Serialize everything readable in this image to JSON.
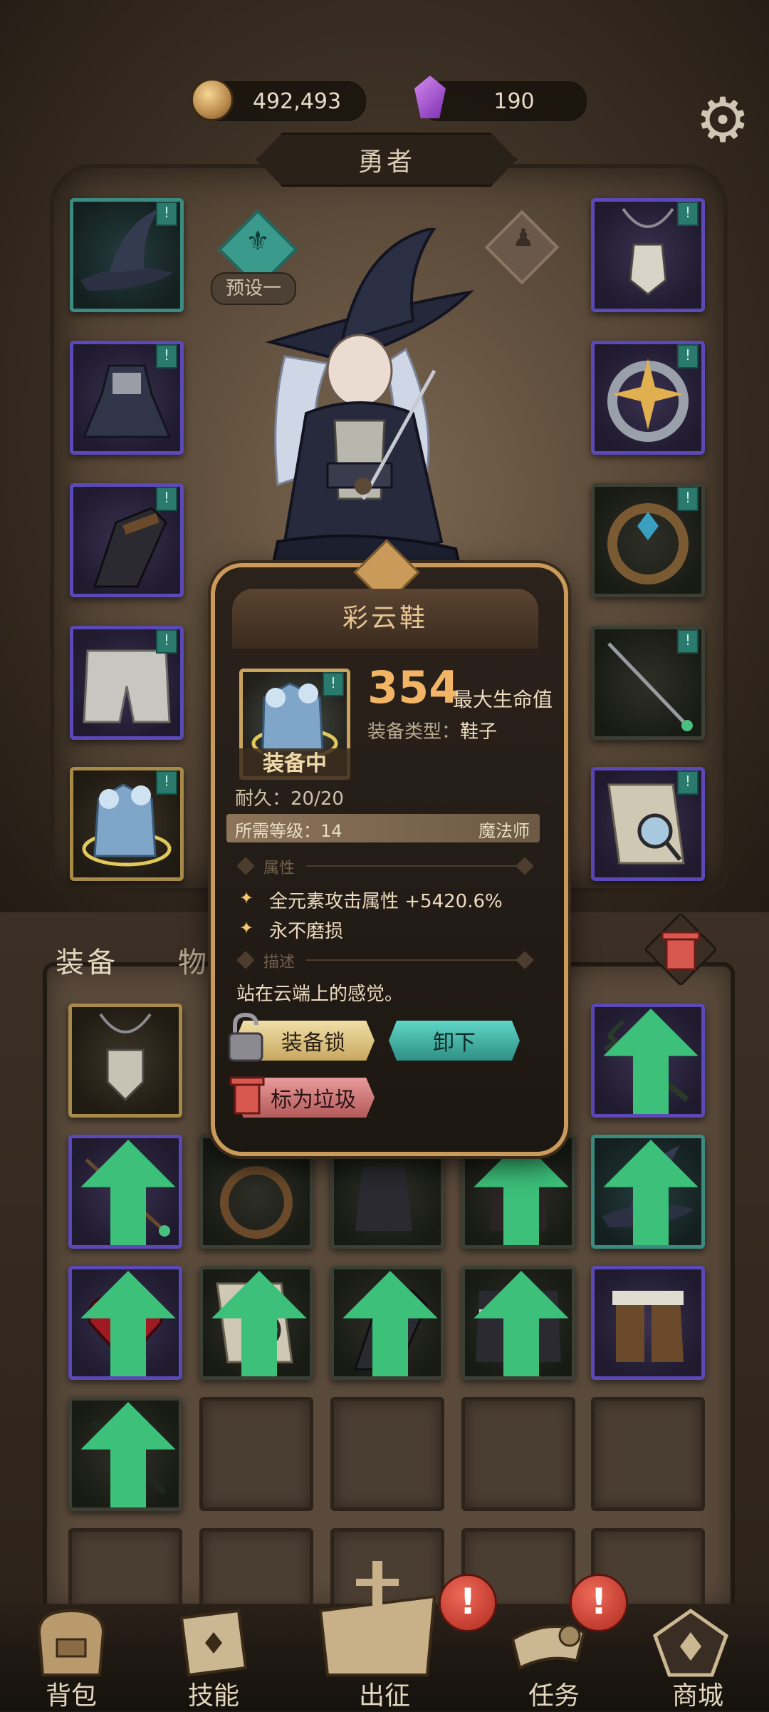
{
  "currency": {
    "gold": "492,493",
    "gems": "190"
  },
  "title": "勇者",
  "preset_label": "预设一",
  "tabs": {
    "equipment": "装备",
    "items": "物"
  },
  "popup": {
    "name": "彩云鞋",
    "stat_value": "354",
    "stat_name": "最大生命值",
    "type_label": "装备类型：",
    "type_value": "鞋子",
    "equipped_label": "装备中",
    "durability": "耐久：20/20",
    "required_level": "所需等级：14",
    "required_class": "魔法师",
    "attributes_header": "属性",
    "attributes": [
      "全元素攻击属性 +5420.6%",
      "永不磨损"
    ],
    "description_header": "描述",
    "description": "站在云端上的感觉。",
    "lock_button": "装备锁",
    "unequip_button": "卸下",
    "junk_button": "标为垃圾"
  },
  "nav": [
    {
      "label": "背包",
      "icon": "backpack-icon"
    },
    {
      "label": "技能",
      "icon": "skill-book-icon"
    },
    {
      "label": "出征",
      "icon": "battle-icon"
    },
    {
      "label": "任务",
      "icon": "quest-icon"
    },
    {
      "label": "商城",
      "icon": "shop-icon"
    }
  ],
  "alerts": [
    "!",
    "!"
  ],
  "colors": {
    "rarity_purple": "#5b49b8",
    "rarity_teal": "#3b8b80",
    "rarity_gold": "#a88a48",
    "highlight_orange": "#f2b566",
    "unequip_teal": "#2f8f84"
  }
}
